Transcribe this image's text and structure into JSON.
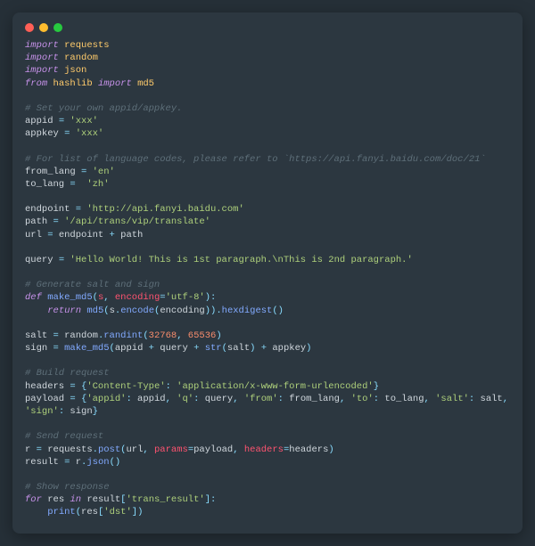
{
  "c1": "# Set your own appid/appkey.",
  "c2": "# For list of language codes, please refer to `https://api.fanyi.baidu.com/doc/21`",
  "c3": "# Generate salt and sign",
  "c4": "# Build request",
  "c5": "# Send request",
  "c6": "# Show response",
  "v_appid": "'xxx'",
  "v_appkey": "'xxx'",
  "v_from": "'en'",
  "v_to": "'zh'",
  "v_endpoint": "'http://api.fanyi.baidu.com'",
  "v_path": "'/api/trans/vip/translate'",
  "v_query": "'Hello World! This is 1st paragraph.\\nThis is 2nd paragraph.'",
  "v_enc": "'utf-8'",
  "n1": "32768",
  "n2": "65536",
  "v_ct": "'Content-Type'",
  "v_ctv": "'application/x-www-form-urlencoded'",
  "k_appid": "'appid'",
  "k_q": "'q'",
  "k_from": "'from'",
  "k_to": "'to'",
  "k_salt": "'salt'",
  "k_sign": "'sign'",
  "v_tr": "'trans_result'",
  "v_dst": "'dst'",
  "kw_import": "import",
  "kw_from": "from",
  "kw_def": "def",
  "kw_return": "return",
  "kw_for": "for",
  "kw_in": "in",
  "m_requests": "requests",
  "m_random": "random",
  "m_json": "json",
  "m_hashlib": "hashlib",
  "m_md5": "md5",
  "id_appid": "appid",
  "id_appkey": "appkey",
  "id_fromlang": "from_lang",
  "id_tolang": "to_lang",
  "id_endpoint": "endpoint",
  "id_path": "path",
  "id_url": "url",
  "id_query": "query",
  "id_makemd5": "make_md5",
  "id_s": "s",
  "id_encoding": "encoding",
  "id_encode": "encode",
  "id_hexdigest": "hexdigest",
  "id_salt": "salt",
  "id_sign": "sign",
  "id_randint": "randint",
  "id_str": "str",
  "id_headers": "headers",
  "id_payload": "payload",
  "id_r": "r",
  "id_post": "post",
  "id_params": "params",
  "id_result": "result",
  "id_jsonc": "json",
  "id_res": "res",
  "id_print": "print",
  "eq": " = ",
  "plus": " + ",
  "colon": ": ",
  "comma": ", "
}
